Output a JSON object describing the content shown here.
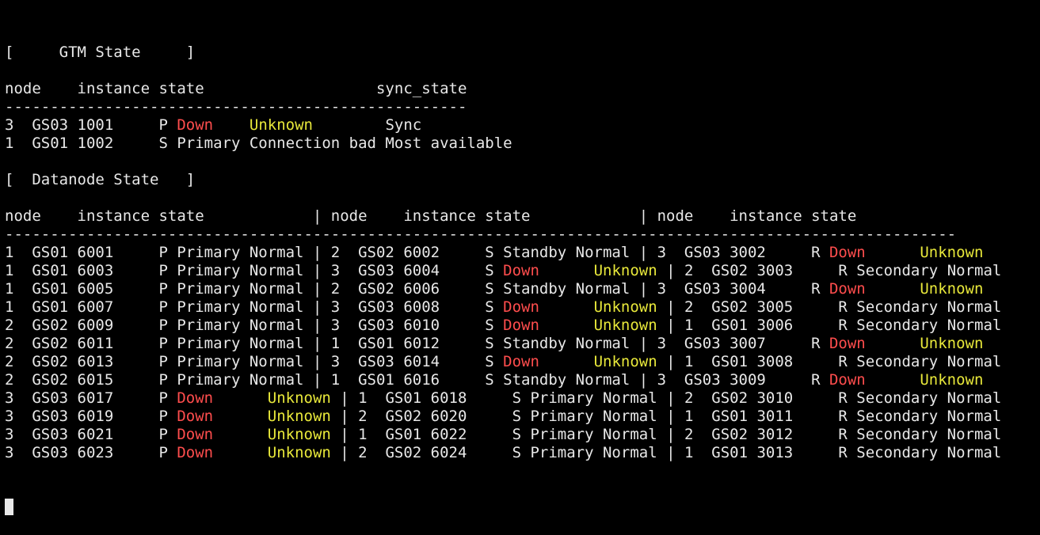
{
  "colors": {
    "background": "#000000",
    "foreground": "#e8e8e8",
    "down": "#ff4d4d",
    "unknown": "#e8e83a"
  },
  "terminal": {
    "lines": [
      {
        "name": "gtm-section-title",
        "segments": [
          {
            "t": "[     GTM State     ]"
          }
        ]
      },
      {
        "name": "blank-line",
        "segments": []
      },
      {
        "name": "gtm-header",
        "segments": [
          {
            "t": "node    instance state                   sync_state"
          }
        ]
      },
      {
        "name": "gtm-separator",
        "segments": [
          {
            "t": "---------------------------------------------------"
          }
        ]
      },
      {
        "name": "gtm-row",
        "segments": [
          {
            "t": "3  GS03 1001     P "
          },
          {
            "t": "Down",
            "c": "red"
          },
          {
            "t": "    "
          },
          {
            "t": "Unknown",
            "c": "yellow"
          },
          {
            "t": "        Sync"
          }
        ]
      },
      {
        "name": "gtm-row",
        "segments": [
          {
            "t": "1  GS01 1002     S Primary Connection bad Most available"
          }
        ]
      },
      {
        "name": "blank-line",
        "segments": []
      },
      {
        "name": "datanode-section-title",
        "segments": [
          {
            "t": "[  Datanode State   ]"
          }
        ]
      },
      {
        "name": "blank-line",
        "segments": []
      },
      {
        "name": "datanode-header",
        "segments": [
          {
            "t": "node    instance state            | node    instance state            | node    instance state"
          }
        ]
      },
      {
        "name": "datanode-separator",
        "segments": [
          {
            "t": "---------------------------------------------------------------------------------------------------------"
          }
        ]
      },
      {
        "name": "datanode-row",
        "segments": [
          {
            "t": "1  GS01 6001     P Primary Normal | 2  GS02 6002     S Standby Normal | 3  GS03 3002     R "
          },
          {
            "t": "Down",
            "c": "red"
          },
          {
            "t": "      "
          },
          {
            "t": "Unknown",
            "c": "yellow"
          }
        ]
      },
      {
        "name": "datanode-row",
        "segments": [
          {
            "t": "1  GS01 6003     P Primary Normal | 3  GS03 6004     S "
          },
          {
            "t": "Down",
            "c": "red"
          },
          {
            "t": "      "
          },
          {
            "t": "Unknown",
            "c": "yellow"
          },
          {
            "t": " | 2  GS02 3003     R Secondary Normal"
          }
        ]
      },
      {
        "name": "datanode-row",
        "segments": [
          {
            "t": "1  GS01 6005     P Primary Normal | 2  GS02 6006     S Standby Normal | 3  GS03 3004     R "
          },
          {
            "t": "Down",
            "c": "red"
          },
          {
            "t": "      "
          },
          {
            "t": "Unknown",
            "c": "yellow"
          }
        ]
      },
      {
        "name": "datanode-row",
        "segments": [
          {
            "t": "1  GS01 6007     P Primary Normal | 3  GS03 6008     S "
          },
          {
            "t": "Down",
            "c": "red"
          },
          {
            "t": "      "
          },
          {
            "t": "Unknown",
            "c": "yellow"
          },
          {
            "t": " | 2  GS02 3005     R Secondary Normal"
          }
        ]
      },
      {
        "name": "datanode-row",
        "segments": [
          {
            "t": "2  GS02 6009     P Primary Normal | 3  GS03 6010     S "
          },
          {
            "t": "Down",
            "c": "red"
          },
          {
            "t": "      "
          },
          {
            "t": "Unknown",
            "c": "yellow"
          },
          {
            "t": " | 1  GS01 3006     R Secondary Normal"
          }
        ]
      },
      {
        "name": "datanode-row",
        "segments": [
          {
            "t": "2  GS02 6011     P Primary Normal | 1  GS01 6012     S Standby Normal | 3  GS03 3007     R "
          },
          {
            "t": "Down",
            "c": "red"
          },
          {
            "t": "      "
          },
          {
            "t": "Unknown",
            "c": "yellow"
          }
        ]
      },
      {
        "name": "datanode-row",
        "segments": [
          {
            "t": "2  GS02 6013     P Primary Normal | 3  GS03 6014     S "
          },
          {
            "t": "Down",
            "c": "red"
          },
          {
            "t": "      "
          },
          {
            "t": "Unknown",
            "c": "yellow"
          },
          {
            "t": " | 1  GS01 3008     R Secondary Normal"
          }
        ]
      },
      {
        "name": "datanode-row",
        "segments": [
          {
            "t": "2  GS02 6015     P Primary Normal | 1  GS01 6016     S Standby Normal | 3  GS03 3009     R "
          },
          {
            "t": "Down",
            "c": "red"
          },
          {
            "t": "      "
          },
          {
            "t": "Unknown",
            "c": "yellow"
          }
        ]
      },
      {
        "name": "datanode-row",
        "segments": [
          {
            "t": "3  GS03 6017     P "
          },
          {
            "t": "Down",
            "c": "red"
          },
          {
            "t": "      "
          },
          {
            "t": "Unknown",
            "c": "yellow"
          },
          {
            "t": " | 1  GS01 6018     S Primary Normal | 2  GS02 3010     R Secondary Normal"
          }
        ]
      },
      {
        "name": "datanode-row",
        "segments": [
          {
            "t": "3  GS03 6019     P "
          },
          {
            "t": "Down",
            "c": "red"
          },
          {
            "t": "      "
          },
          {
            "t": "Unknown",
            "c": "yellow"
          },
          {
            "t": " | 2  GS02 6020     S Primary Normal | 1  GS01 3011     R Secondary Normal"
          }
        ]
      },
      {
        "name": "datanode-row",
        "segments": [
          {
            "t": "3  GS03 6021     P "
          },
          {
            "t": "Down",
            "c": "red"
          },
          {
            "t": "      "
          },
          {
            "t": "Unknown",
            "c": "yellow"
          },
          {
            "t": " | 1  GS01 6022     S Primary Normal | 2  GS02 3012     R Secondary Normal"
          }
        ]
      },
      {
        "name": "datanode-row",
        "segments": [
          {
            "t": "3  GS03 6023     P "
          },
          {
            "t": "Down",
            "c": "red"
          },
          {
            "t": "      "
          },
          {
            "t": "Unknown",
            "c": "yellow"
          },
          {
            "t": " | 2  GS02 6024     S Primary Normal | 1  GS01 3013     R Secondary Normal"
          }
        ]
      }
    ]
  }
}
